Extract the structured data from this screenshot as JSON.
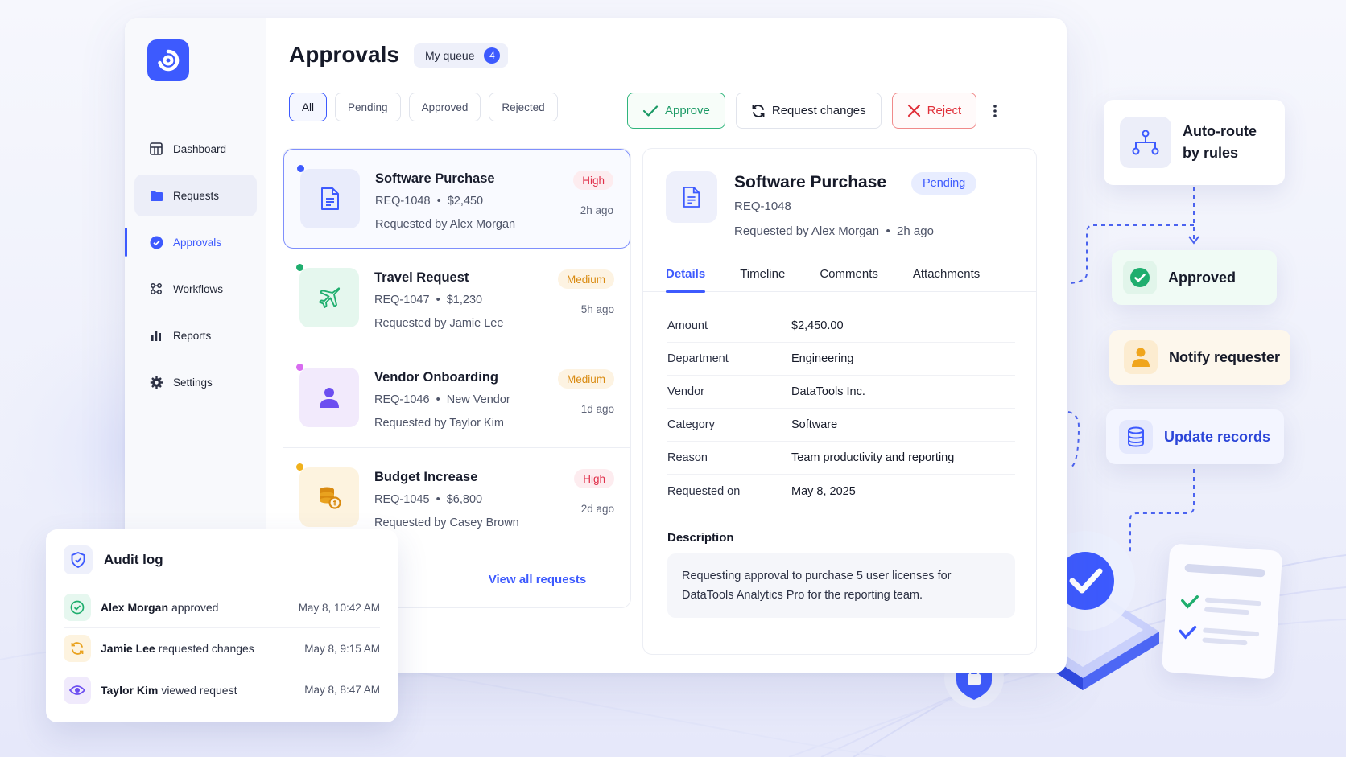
{
  "sidebar": {
    "items": [
      {
        "label": "Dashboard",
        "icon": "dashboard-icon"
      },
      {
        "label": "Requests",
        "icon": "folder-icon"
      },
      {
        "label": "Approvals",
        "icon": "check-circle-icon"
      },
      {
        "label": "Workflows",
        "icon": "workflow-icon"
      },
      {
        "label": "Reports",
        "icon": "bar-chart-icon"
      },
      {
        "label": "Settings",
        "icon": "gear-icon"
      }
    ]
  },
  "header": {
    "title": "Approvals",
    "queue_label": "My queue",
    "queue_count": "4"
  },
  "filters": [
    "All",
    "Pending",
    "Approved",
    "Rejected"
  ],
  "actions": {
    "approve": "Approve",
    "request_changes": "Request changes",
    "reject": "Reject"
  },
  "requests": [
    {
      "title": "Software Purchase",
      "id": "REQ-1048",
      "detail": "$2,450",
      "by": "Requested by Alex Morgan",
      "priority": "High",
      "ago": "2h ago",
      "icon": "document-icon",
      "dot": "#3d5afe"
    },
    {
      "title": "Travel Request",
      "id": "REQ-1047",
      "detail": "$1,230",
      "by": "Requested by Jamie Lee",
      "priority": "Medium",
      "ago": "5h ago",
      "icon": "airplane-icon",
      "dot": "#1fae6e"
    },
    {
      "title": "Vendor Onboarding",
      "id": "REQ-1046",
      "detail": "New Vendor",
      "by": "Requested by Taylor Kim",
      "priority": "Medium",
      "ago": "1d ago",
      "icon": "user-icon",
      "dot": "#d86cf0"
    },
    {
      "title": "Budget Increase",
      "id": "REQ-1045",
      "detail": "$6,800",
      "by": "Requested by Casey Brown",
      "priority": "High",
      "ago": "2d ago",
      "icon": "coins-icon",
      "dot": "#f0b11c"
    }
  ],
  "list_footer": "View all requests",
  "detail": {
    "title": "Software Purchase",
    "status": "Pending",
    "id": "REQ-1048",
    "requested_by": "Requested by Alex Morgan",
    "ago": "2h ago",
    "tabs": [
      "Details",
      "Timeline",
      "Comments",
      "Attachments"
    ],
    "fields": [
      {
        "k": "Amount",
        "v": "$2,450.00"
      },
      {
        "k": "Department",
        "v": "Engineering"
      },
      {
        "k": "Vendor",
        "v": "DataTools Inc."
      },
      {
        "k": "Category",
        "v": "Software"
      },
      {
        "k": "Reason",
        "v": "Team productivity and reporting"
      },
      {
        "k": "Requested on",
        "v": "May 8, 2025"
      }
    ],
    "description_label": "Description",
    "description": "Requesting approval to purchase 5 user licenses for DataTools Analytics Pro for the reporting team."
  },
  "audit": {
    "title": "Audit log",
    "rows": [
      {
        "who": "Alex Morgan",
        "what": "approved",
        "when": "May 8, 10:42 AM"
      },
      {
        "who": "Jamie Lee",
        "what": "requested changes",
        "when": "May 8, 9:15 AM"
      },
      {
        "who": "Taylor Kim",
        "what": "viewed request",
        "when": "May 8, 8:47 AM"
      }
    ]
  },
  "workflow": {
    "auto_route_1": "Auto-route",
    "auto_route_2": "by rules",
    "approved": "Approved",
    "notify": "Notify requester",
    "update": "Update records"
  },
  "colors": {
    "accent": "#3d5afe",
    "success": "#1fae6e",
    "danger": "#e0303a",
    "warning": "#d98a10"
  }
}
